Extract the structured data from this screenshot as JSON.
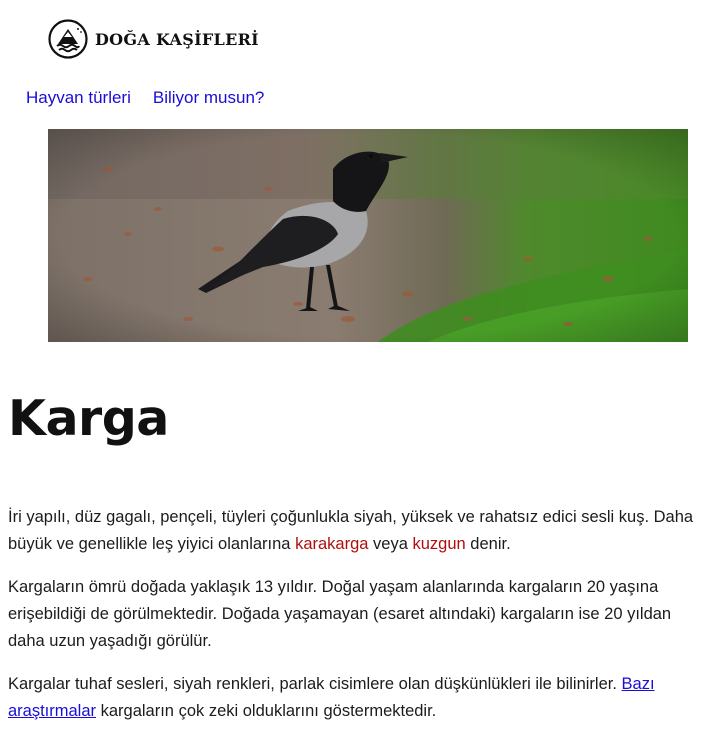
{
  "brand": {
    "name": "DOĞA KAŞİFLERİ",
    "logo_icon": "mountain-sea-emblem-icon"
  },
  "nav": {
    "items": [
      {
        "label": "Hayvan türleri"
      },
      {
        "label": "Biliyor musun?"
      }
    ]
  },
  "hero": {
    "subject": "hooded-crow-photo"
  },
  "article": {
    "title": "Karga",
    "p1": {
      "text_a": "İri yapılı, düz gagalı, pençeli, tüyleri çoğunlukla siyah, yüksek ve rahatsız edici sesli kuş. Daha büyük ve genellikle leş yiyici olanlarına ",
      "link1": "karakarga",
      "text_b": " veya ",
      "link2": "kuzgun",
      "text_c": " denir."
    },
    "p2": "Kargaların ömrü doğada yaklaşık 13 yıldır. Doğal yaşam alanlarında kargaların 20 yaşına erişebildiği de görülmektedir. Doğada yaşamayan (esaret altındaki) kargaların ise 20 yıldan daha uzun yaşadığı görülür.",
    "p3": {
      "text_a": "Kargalar tuhaf sesleri, siyah renkleri, parlak cisimlere olan düşkünlükleri ile bilinirler. ",
      "link": "Bazı araştırmalar",
      "text_b": " kargaların çok zeki olduklarını göstermektedir."
    }
  },
  "colors": {
    "link_blue": "#1a0dd6",
    "term_red": "#b00e0e",
    "text": "#1c1c1c"
  }
}
